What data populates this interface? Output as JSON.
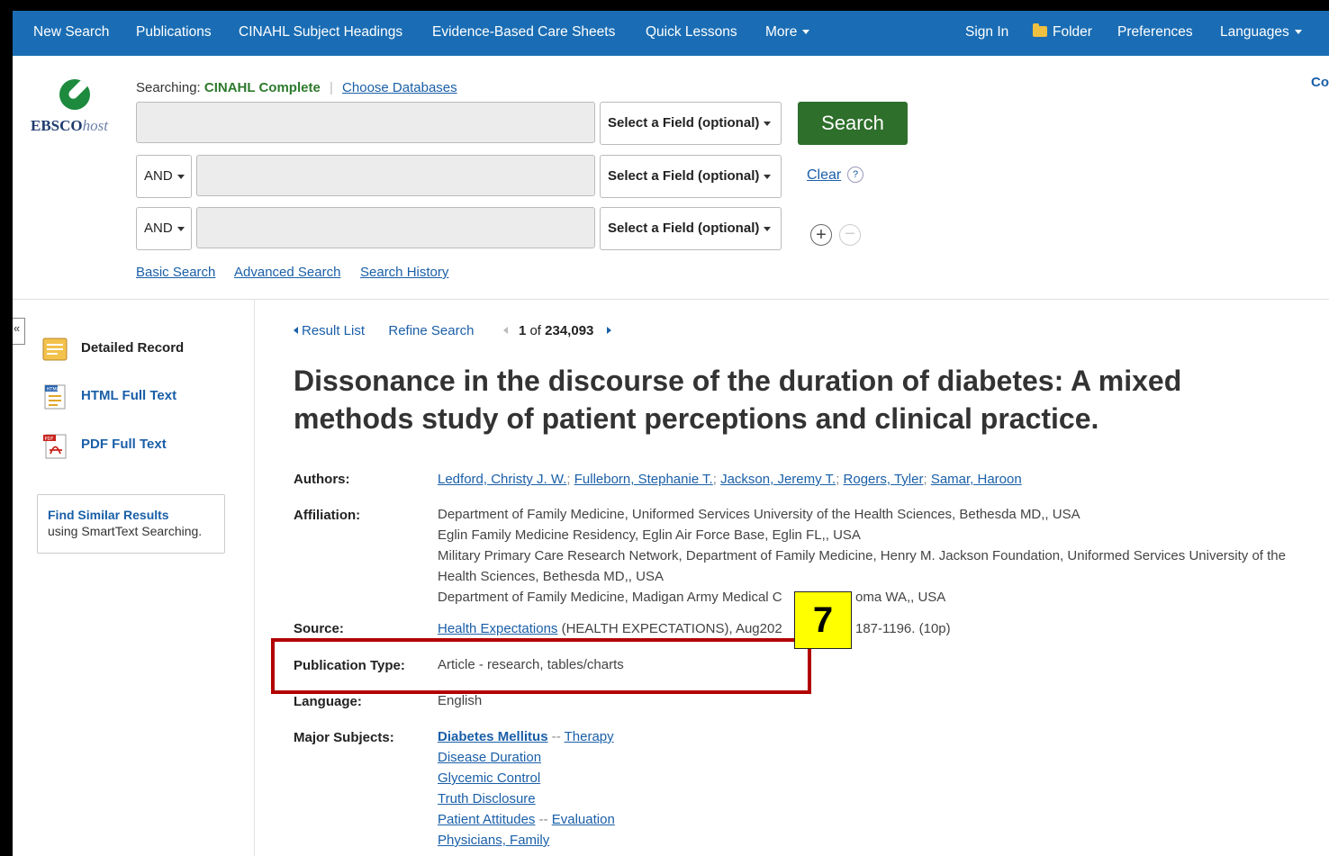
{
  "nav": {
    "left": [
      "New Search",
      "Publications",
      "CINAHL Subject Headings",
      "Evidence-Based Care Sheets",
      "Quick Lessons"
    ],
    "more": "More",
    "sign_in": "Sign In",
    "folder": "Folder",
    "preferences": "Preferences",
    "languages": "Languages"
  },
  "logo": {
    "brand": "EBSCO",
    "brand_suffix": "host"
  },
  "search": {
    "searching_label": "Searching:",
    "database": "CINAHL Complete",
    "choose_db": "Choose Databases",
    "field_label": "Select a Field (optional)",
    "bool_op": "AND",
    "search_button": "Search",
    "clear": "Clear",
    "help": "?",
    "corner_link": "Co",
    "basic_search": "Basic Search",
    "advanced_search": "Advanced Search",
    "search_history": "Search History"
  },
  "sidebar": {
    "collapse": "«",
    "detailed_record": "Detailed Record",
    "html_full_text": "HTML Full Text",
    "pdf_full_text": "PDF Full Text",
    "find_similar": "Find Similar Results",
    "find_similar_sub": "using SmartText Searching."
  },
  "result_nav": {
    "result_list": "Result List",
    "refine_search": "Refine Search",
    "position": "1",
    "of_label": "of",
    "total": "234,093"
  },
  "record": {
    "title": "Dissonance in the discourse of the duration of diabetes: A mixed methods study of patient perceptions and clinical practice.",
    "authors_label": "Authors:",
    "authors": [
      "Ledford, Christy J. W.",
      "Fulleborn, Stephanie T.",
      "Jackson, Jeremy T.",
      "Rogers, Tyler",
      "Samar, Haroon"
    ],
    "affiliation_label": "Affiliation:",
    "affiliations": [
      "Department of Family Medicine, Uniformed Services University of the Health Sciences, Bethesda MD,, USA",
      "Eglin Family Medicine Residency, Eglin Air Force Base, Eglin FL,, USA",
      "Military Primary Care Research Network, Department of Family Medicine, Henry M. Jackson Foundation, Uniformed Services University of the",
      "Health Sciences, Bethesda MD,, USA",
      "Department of Family Medicine, Madigan Army Medical C",
      "oma WA,, USA"
    ],
    "source_label": "Source:",
    "source_link": "Health Expectations",
    "source_rest": " (HEALTH EXPECTATIONS), Aug202",
    "source_rest2": "187-1196. (10p)",
    "pubtype_label": "Publication Type:",
    "pubtype": "Article - research, tables/charts",
    "language_label": "Language:",
    "language": "English",
    "subjects_label": "Major Subjects:",
    "subjects": {
      "s1_main": "Diabetes Mellitus",
      "s1_sep": " -- ",
      "s1_sub": "Therapy",
      "s2": "Disease Duration",
      "s3": "Glycemic Control",
      "s4": "Truth Disclosure",
      "s5_main": "Patient Attitudes",
      "s5_sep": " -- ",
      "s5_sub": "Evaluation",
      "s6": "Physicians, Family"
    }
  },
  "annotation": {
    "number": "7",
    "box_color": "#b20000",
    "badge_color": "#ffff00"
  },
  "colors": {
    "nav_bg": "#1a6db4",
    "search_btn": "#2e6f2b",
    "link": "#1a5fa8"
  }
}
